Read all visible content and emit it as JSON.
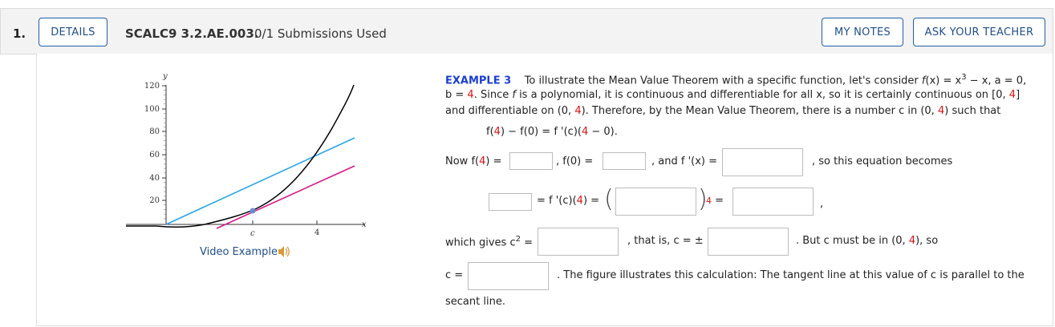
{
  "question": {
    "number": "1.",
    "details_label": "DETAILS",
    "title": "SCALC9 3.2.AE.003.",
    "submissions": "0/1 Submissions Used",
    "my_notes_label": "MY NOTES",
    "ask_teacher_label": "ASK YOUR TEACHER"
  },
  "figure": {
    "y_axis_label": "y",
    "x_axis_label": "x",
    "y_ticks": [
      "120",
      "100",
      "80",
      "60",
      "40",
      "20"
    ],
    "c_label": "c",
    "x_tick_4": "4",
    "curve_color": "#000000",
    "secant_color": "#2aa6e8",
    "tangent_color": "#d6198a",
    "point_color": "#6a8fd0",
    "video_link": "Video Example",
    "speaker_icon": "speaker-icon"
  },
  "example": {
    "label": "EXAMPLE 3",
    "line1_a": "To illustrate the Mean Value Theorem with a specific function, let's consider ",
    "line1_fx": "f",
    "line1_b": "(x) = x",
    "line1_exp": "3",
    "line1_c": " − x, a = 0,",
    "line2_a": "b = ",
    "line2_b4": "4",
    "line2_c": ". Since ",
    "line2_f": "f",
    "line2_d": " is a polynomial, it is continuous and differentiable for all x, so it is certainly continuous on [0, ",
    "line2_e4": "4",
    "line2_f_end": "]",
    "line3_a": "and differentiable on (0, ",
    "line3_b4": "4",
    "line3_c": "). Therefore, by the Mean Value Theorem, there is a number c in (0, ",
    "line3_d4": "4",
    "line3_e": ") such that",
    "eq_a": "f(",
    "eq_b4": "4",
    "eq_c": ") − f(0) = f '(c)(",
    "eq_d4": "4",
    "eq_e": " − 0).",
    "now_a": "Now f(",
    "now_b4": "4",
    "now_c": ") =",
    "f0": ", f(0) =",
    "fprime": ", and f '(x) =",
    "becomes": ", so this equation becomes",
    "mid_eq_a": "= f '(c)(",
    "mid_eq_b4": "4",
    "mid_eq_c": ") =",
    "exp4": "4",
    "exp_eq": " =",
    "comma": ",",
    "gives_a": "which gives c",
    "gives_exp": "2",
    "gives_b": " =",
    "thatis": ", that is, c = ±",
    "but_a": ". But c must be in (0, ",
    "but_b4": "4",
    "but_c": "), so",
    "c_eq": "c =",
    "figure_a": ". The figure illustrates this calculation: The tangent line at this value of c is parallel to the",
    "figure_b": "secant line."
  },
  "inputs": {
    "f4_value": "",
    "f0_value": "",
    "fprime_value": "",
    "lhs_value": "",
    "paren_value": "",
    "rhs_value": "",
    "c2_value": "",
    "pm_value": "",
    "c_value": ""
  }
}
